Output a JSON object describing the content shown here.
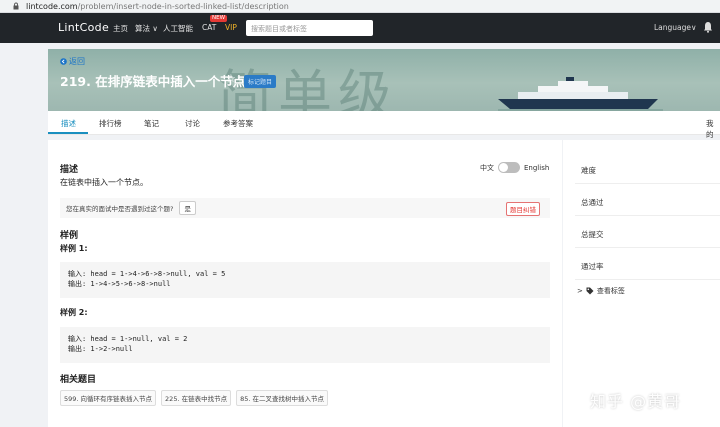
{
  "browser": {
    "url_host": "lintcode.com",
    "url_path": "/problem/insert-node-in-sorted-linked-list/description"
  },
  "topnav": {
    "logo": "LintCode",
    "items": [
      "主页",
      "算法",
      "人工智能",
      "CAT",
      "VIP"
    ],
    "new_badge": "NEW",
    "search_placeholder": "搜索题目或者标签",
    "language": "Language"
  },
  "banner": {
    "back": "返回",
    "title": "219. 在排序链表中插入一个节点",
    "star": "☆",
    "tag_button": "标记题目",
    "watermark": "简单级"
  },
  "tabs": [
    "描述",
    "排行榜",
    "笔记",
    "讨论",
    "参考答案"
  ],
  "tab_right": "我的",
  "main": {
    "description_heading": "描述",
    "description": "在链表中插入一个节点。",
    "lang_zh": "中文",
    "lang_en": "English",
    "interview_question": "您在真实的面试中是否遇到过这个题?",
    "interview_yes": "是",
    "report": "题目纠错",
    "sample_heading": "样例",
    "example1_heading": "样例 1:",
    "example1_line1": "输入: head = 1->4->6->8->null, val = 5",
    "example1_line2": "输出: 1->4->5->6->8->null",
    "example2_heading": "样例 2:",
    "example2_line1": "输入: head = 1->null, val = 2",
    "example2_line2": "输出: 1->2->null",
    "related_heading": "相关题目",
    "related": [
      "599. 向循环有序链表插入节点",
      "225. 在链表中找节点",
      "85. 在二叉查找树中插入节点"
    ]
  },
  "sidebar": {
    "rows": [
      "难度",
      "总通过",
      "总提交",
      "通过率"
    ],
    "view_tags": "查看标签"
  },
  "watermark_overlay": "知乎 @黄哥",
  "colors": {
    "nav_bg": "#212529",
    "accent": "#1a8fbf",
    "vip": "#f0b429",
    "report": "#e53935"
  }
}
